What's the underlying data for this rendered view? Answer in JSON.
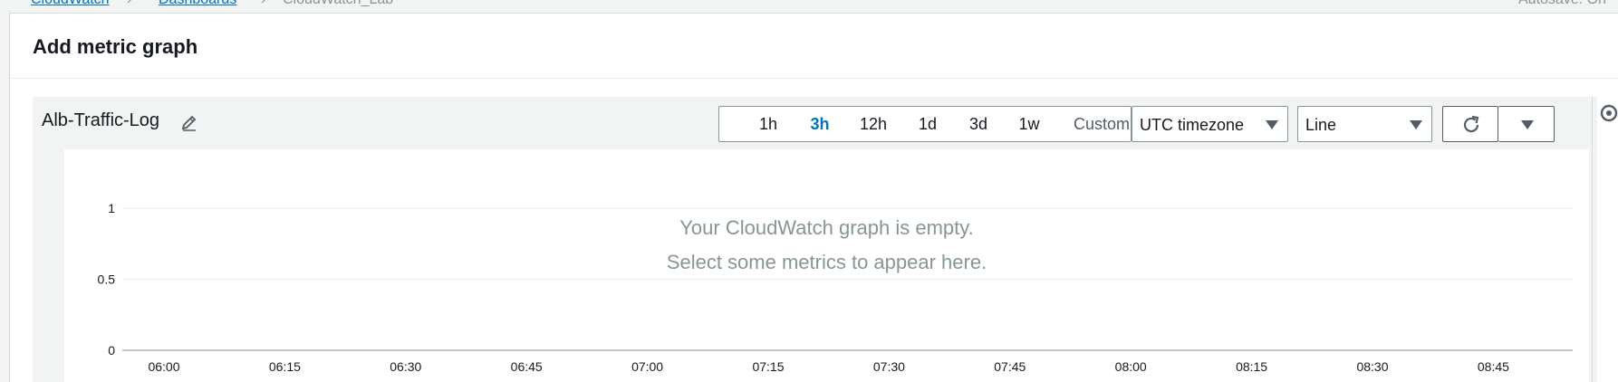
{
  "breadcrumb": {
    "items": [
      "CloudWatch",
      "Dashboards",
      "CloudWatch_Lab"
    ],
    "right_text": "Autosave: On"
  },
  "modal": {
    "title": "Add metric graph"
  },
  "graph": {
    "title": "Alb-Traffic-Log",
    "time_ranges": [
      "1h",
      "3h",
      "12h",
      "1d",
      "3d",
      "1w"
    ],
    "active_range": "3h",
    "custom_label": "Custom",
    "timezone": "UTC timezone",
    "graph_type": "Line",
    "empty_message_line1": "Your CloudWatch graph is empty.",
    "empty_message_line2": "Select some metrics to appear here."
  },
  "icons": {
    "edit": "pencil-icon",
    "calendar": "calendar-icon",
    "refresh": "refresh-icon",
    "dropdown": "caret-down-icon",
    "side": "settings-icon"
  },
  "chart_data": {
    "type": "line",
    "title": "",
    "xlabel": "",
    "ylabel": "",
    "x_ticks": [
      "06:00",
      "06:15",
      "06:30",
      "06:45",
      "07:00",
      "07:15",
      "07:30",
      "07:45",
      "08:00",
      "08:15",
      "08:30",
      "08:45"
    ],
    "y_ticks": [
      "0",
      "0.5",
      "1"
    ],
    "ylim": [
      0,
      1
    ],
    "series": [],
    "grid": true
  },
  "colors": {
    "accent": "#0073bb",
    "muted_text": "#879596",
    "grid": "#eaeded",
    "axis": "#aab7b8"
  }
}
